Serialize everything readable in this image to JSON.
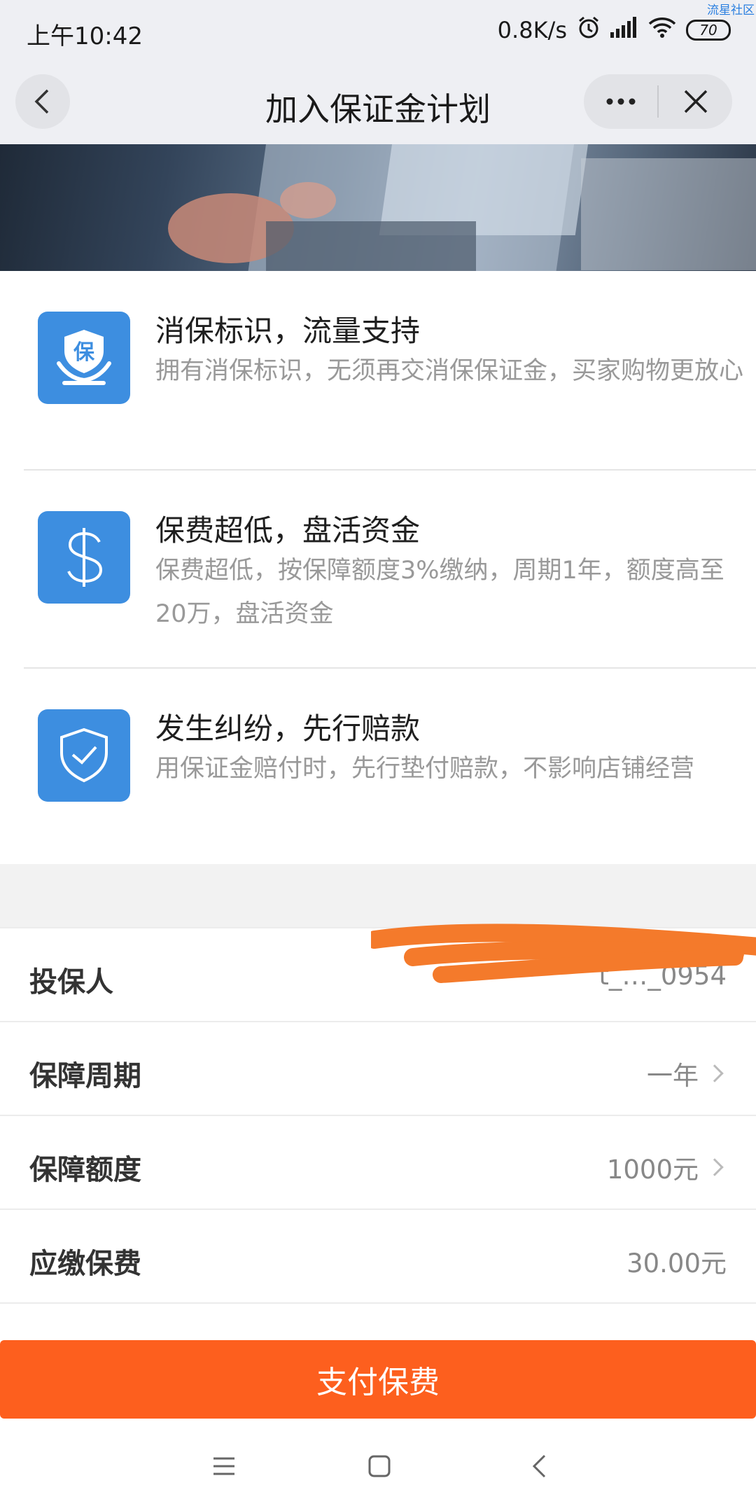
{
  "status_bar": {
    "time": "上午10:42",
    "net_speed": "0.8K/s",
    "battery": "70",
    "watermark": "流星社区",
    "icons": [
      "alarm-icon",
      "signal-icon",
      "wifi-icon",
      "battery-icon"
    ]
  },
  "nav": {
    "title": "加入保证金计划",
    "icons": [
      "back-icon",
      "more-icon",
      "close-icon"
    ]
  },
  "features": [
    {
      "title": "消保标识，流量支持",
      "desc": "拥有消保标识，无须再交消保保证金，买家购物更放心",
      "icon": "protection-badge-icon",
      "icon_text": "保"
    },
    {
      "title": "保费超低，盘活资金",
      "desc": "保费超低，按保障额度3%缴纳，周期1年，额度高至20万，盘活资金",
      "icon": "dollar-icon"
    },
    {
      "title": "发生纠纷，先行赔款",
      "desc": "用保证金赔付时，先行垫付赔款，不影响店铺经营",
      "icon": "shield-check-icon"
    }
  ],
  "form": {
    "rows": [
      {
        "label": "投保人",
        "value": "t_…_0954"
      },
      {
        "label": "保障周期",
        "value": "一年"
      },
      {
        "label": "保障额度",
        "value": "1000元"
      },
      {
        "label": "应缴保费",
        "value": "30.00元"
      }
    ]
  },
  "pay_button": "支付保费",
  "colors": {
    "accent": "#fd5f1e",
    "icon_blue": "#3d8ee0",
    "redaction": "#f47a2b",
    "header_bg": "#eeeff3"
  }
}
